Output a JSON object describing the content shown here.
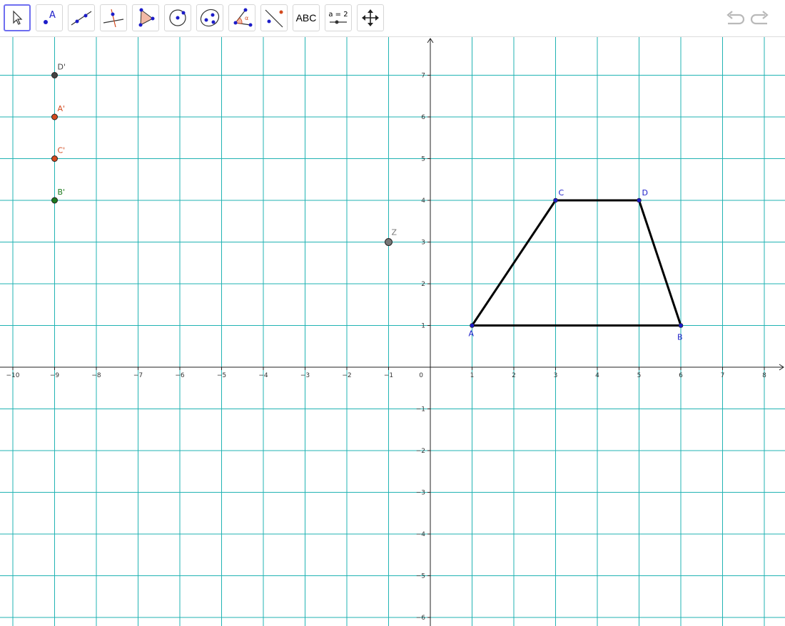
{
  "toolbar": {
    "tools": [
      {
        "name": "move-tool",
        "label": ""
      },
      {
        "name": "point-tool",
        "label": "A"
      },
      {
        "name": "line-tool",
        "label": ""
      },
      {
        "name": "perpendicular-line-tool",
        "label": ""
      },
      {
        "name": "polygon-tool",
        "label": ""
      },
      {
        "name": "circle-center-point-tool",
        "label": ""
      },
      {
        "name": "ellipse-tool",
        "label": ""
      },
      {
        "name": "angle-tool",
        "label": "α"
      },
      {
        "name": "reflect-about-line-tool",
        "label": ""
      },
      {
        "name": "text-tool",
        "label": "ABC"
      },
      {
        "name": "slider-tool",
        "label": "a = 2"
      },
      {
        "name": "move-graphics-view-tool",
        "label": ""
      }
    ],
    "selected_tool": "move-tool"
  },
  "colors": {
    "grid": "#21b3b3",
    "axis": "#222222",
    "polygon": "#000000",
    "point_blue": "#1c1cc8",
    "a_prime": "#d24a1e",
    "b_prime": "#1e7a1e",
    "c_prime": "#d24a1e",
    "d_prime": "#444444",
    "z": "#777777"
  },
  "axes": {
    "x_range": [
      -10,
      8
    ],
    "y_range": [
      -6,
      7
    ],
    "x_ticks": [
      -10,
      -9,
      -8,
      -7,
      -6,
      -5,
      -4,
      -3,
      -2,
      -1,
      0,
      1,
      2,
      3,
      4,
      5,
      6,
      7,
      8
    ],
    "y_ticks": [
      -6,
      -5,
      -4,
      -3,
      -2,
      -1,
      1,
      2,
      3,
      4,
      5,
      6,
      7
    ],
    "origin_label": "0"
  },
  "points": [
    {
      "label": "A",
      "x": 1,
      "y": 1,
      "color": "#1c1cc8"
    },
    {
      "label": "B",
      "x": 6,
      "y": 1,
      "color": "#1c1cc8"
    },
    {
      "label": "C",
      "x": 3,
      "y": 4,
      "color": "#1c1cc8"
    },
    {
      "label": "D",
      "x": 5,
      "y": 4,
      "color": "#1c1cc8"
    },
    {
      "label": "Z",
      "x": -1,
      "y": 3,
      "color": "#777777"
    },
    {
      "label": "D'",
      "x": -9,
      "y": 7,
      "color": "#444444"
    },
    {
      "label": "A'",
      "x": -9,
      "y": 6,
      "color": "#d24a1e"
    },
    {
      "label": "C'",
      "x": -9,
      "y": 5,
      "color": "#d24a1e"
    },
    {
      "label": "B'",
      "x": -9,
      "y": 4,
      "color": "#1e7a1e"
    }
  ],
  "polygon": [
    "A",
    "B",
    "D",
    "C"
  ]
}
